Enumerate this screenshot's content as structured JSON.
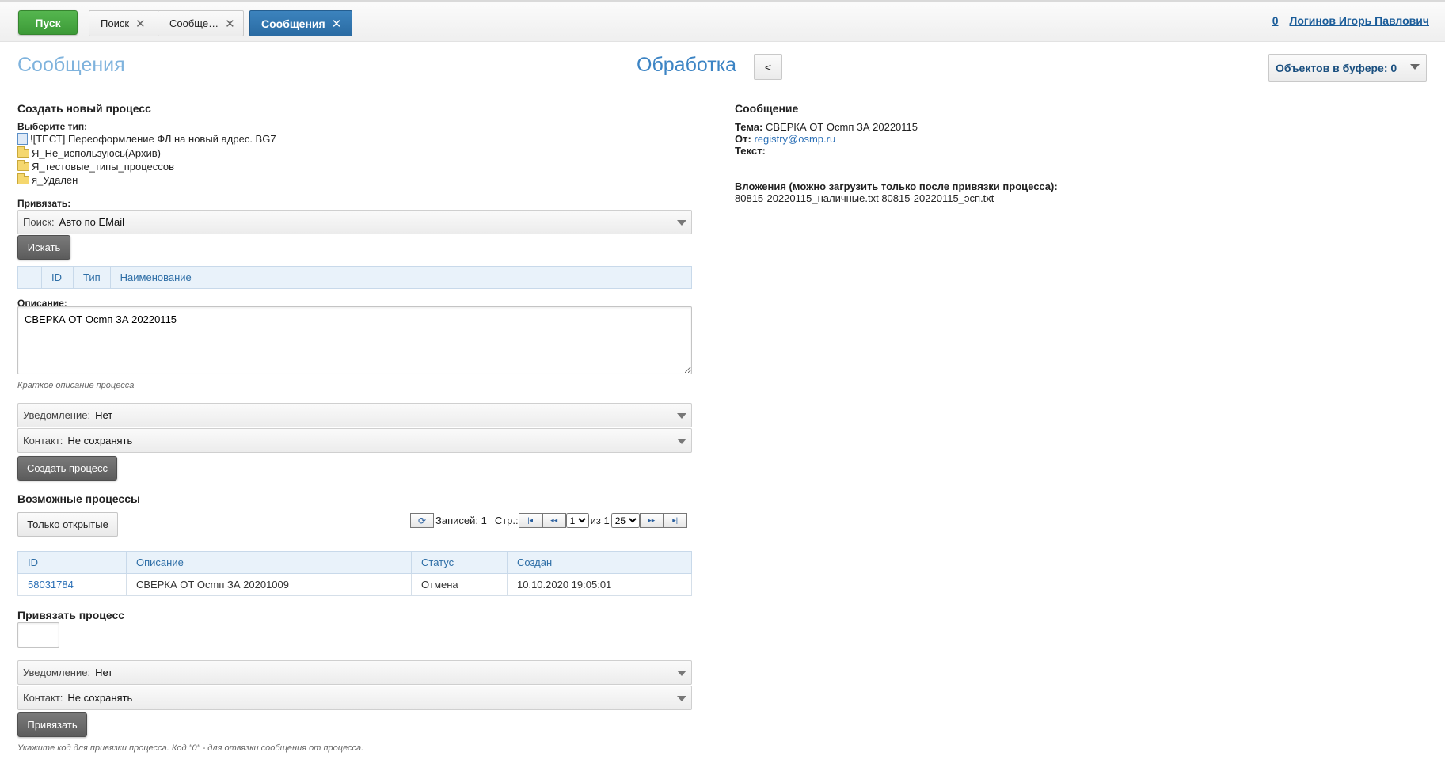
{
  "topbar": {
    "start_label": "Пуск",
    "tabs": [
      {
        "label": "Поиск"
      },
      {
        "label": "Сообще…"
      },
      {
        "label": "Сообщения"
      }
    ],
    "counter": "0",
    "user_name": "Логинов Игорь Павлович"
  },
  "header": {
    "page_title": "Сообщения",
    "process_title": "Обработка",
    "back_label": "<",
    "buffer_label": "Объектов в буфере: 0"
  },
  "create": {
    "title": "Создать новый процесс",
    "type_label": "Выберите тип:",
    "types": [
      {
        "label": "![ТЕСТ] Переоформление ФЛ на новый адрес. BG7",
        "icon": "document-icon"
      },
      {
        "label": "Я_Не_используюсь(Архив)",
        "icon": "folder-icon"
      },
      {
        "label": "Я_тестовые_типы_процессов",
        "icon": "folder-icon"
      },
      {
        "label": "я_Удален",
        "icon": "folder-icon"
      }
    ],
    "bind_label": "Привязать:",
    "search_key": "Поиск:",
    "search_value": "Авто по EMail",
    "search_button": "Искать",
    "bind_columns": [
      "ID",
      "Тип",
      "Наименование"
    ],
    "description_label": "Описание:",
    "description_value": "СВЕРКА ОТ Осmп ЗА 20220115",
    "description_hint": "Краткое описание процесса",
    "notify_key": "Уведомление:",
    "notify_value": "Нет",
    "contact_key": "Контакт:",
    "contact_value": "Не сохранять",
    "create_button": "Создать процесс"
  },
  "possible": {
    "title": "Возможные процессы",
    "only_open_button": "Только открытые",
    "records_label": "Записей: 1",
    "page_label": "Стр.:",
    "page_value": "1",
    "of_label": "из 1",
    "page_size": "25",
    "columns": [
      "ID",
      "Описание",
      "Статус",
      "Создан"
    ],
    "rows": [
      {
        "id": "58031784",
        "description": "СВЕРКА ОТ Осmп ЗА 20201009",
        "status": "Отмена",
        "created": "10.10.2020 19:05:01"
      }
    ]
  },
  "link": {
    "title": "Привязать процесс",
    "notify_key": "Уведомление:",
    "notify_value": "Нет",
    "contact_key": "Контакт:",
    "contact_value": "Не сохранять",
    "link_button": "Привязать",
    "hint": "Укажите код для привязки процесса. Код \"0\" - для отвязки сообщения от процесса."
  },
  "message": {
    "title": "Сообщение",
    "subject_label": "Тема:",
    "subject_value": "СВЕРКА ОТ Осmп ЗА 20220115",
    "from_label": "От:",
    "from_value": "registry@osmp.ru",
    "text_label": "Текст:",
    "attachments_label": "Вложения (можно загрузить только после привязки процесса):",
    "attachments_value": "80815-20220115_наличные.txt 80815-20220115_эсп.txt"
  }
}
